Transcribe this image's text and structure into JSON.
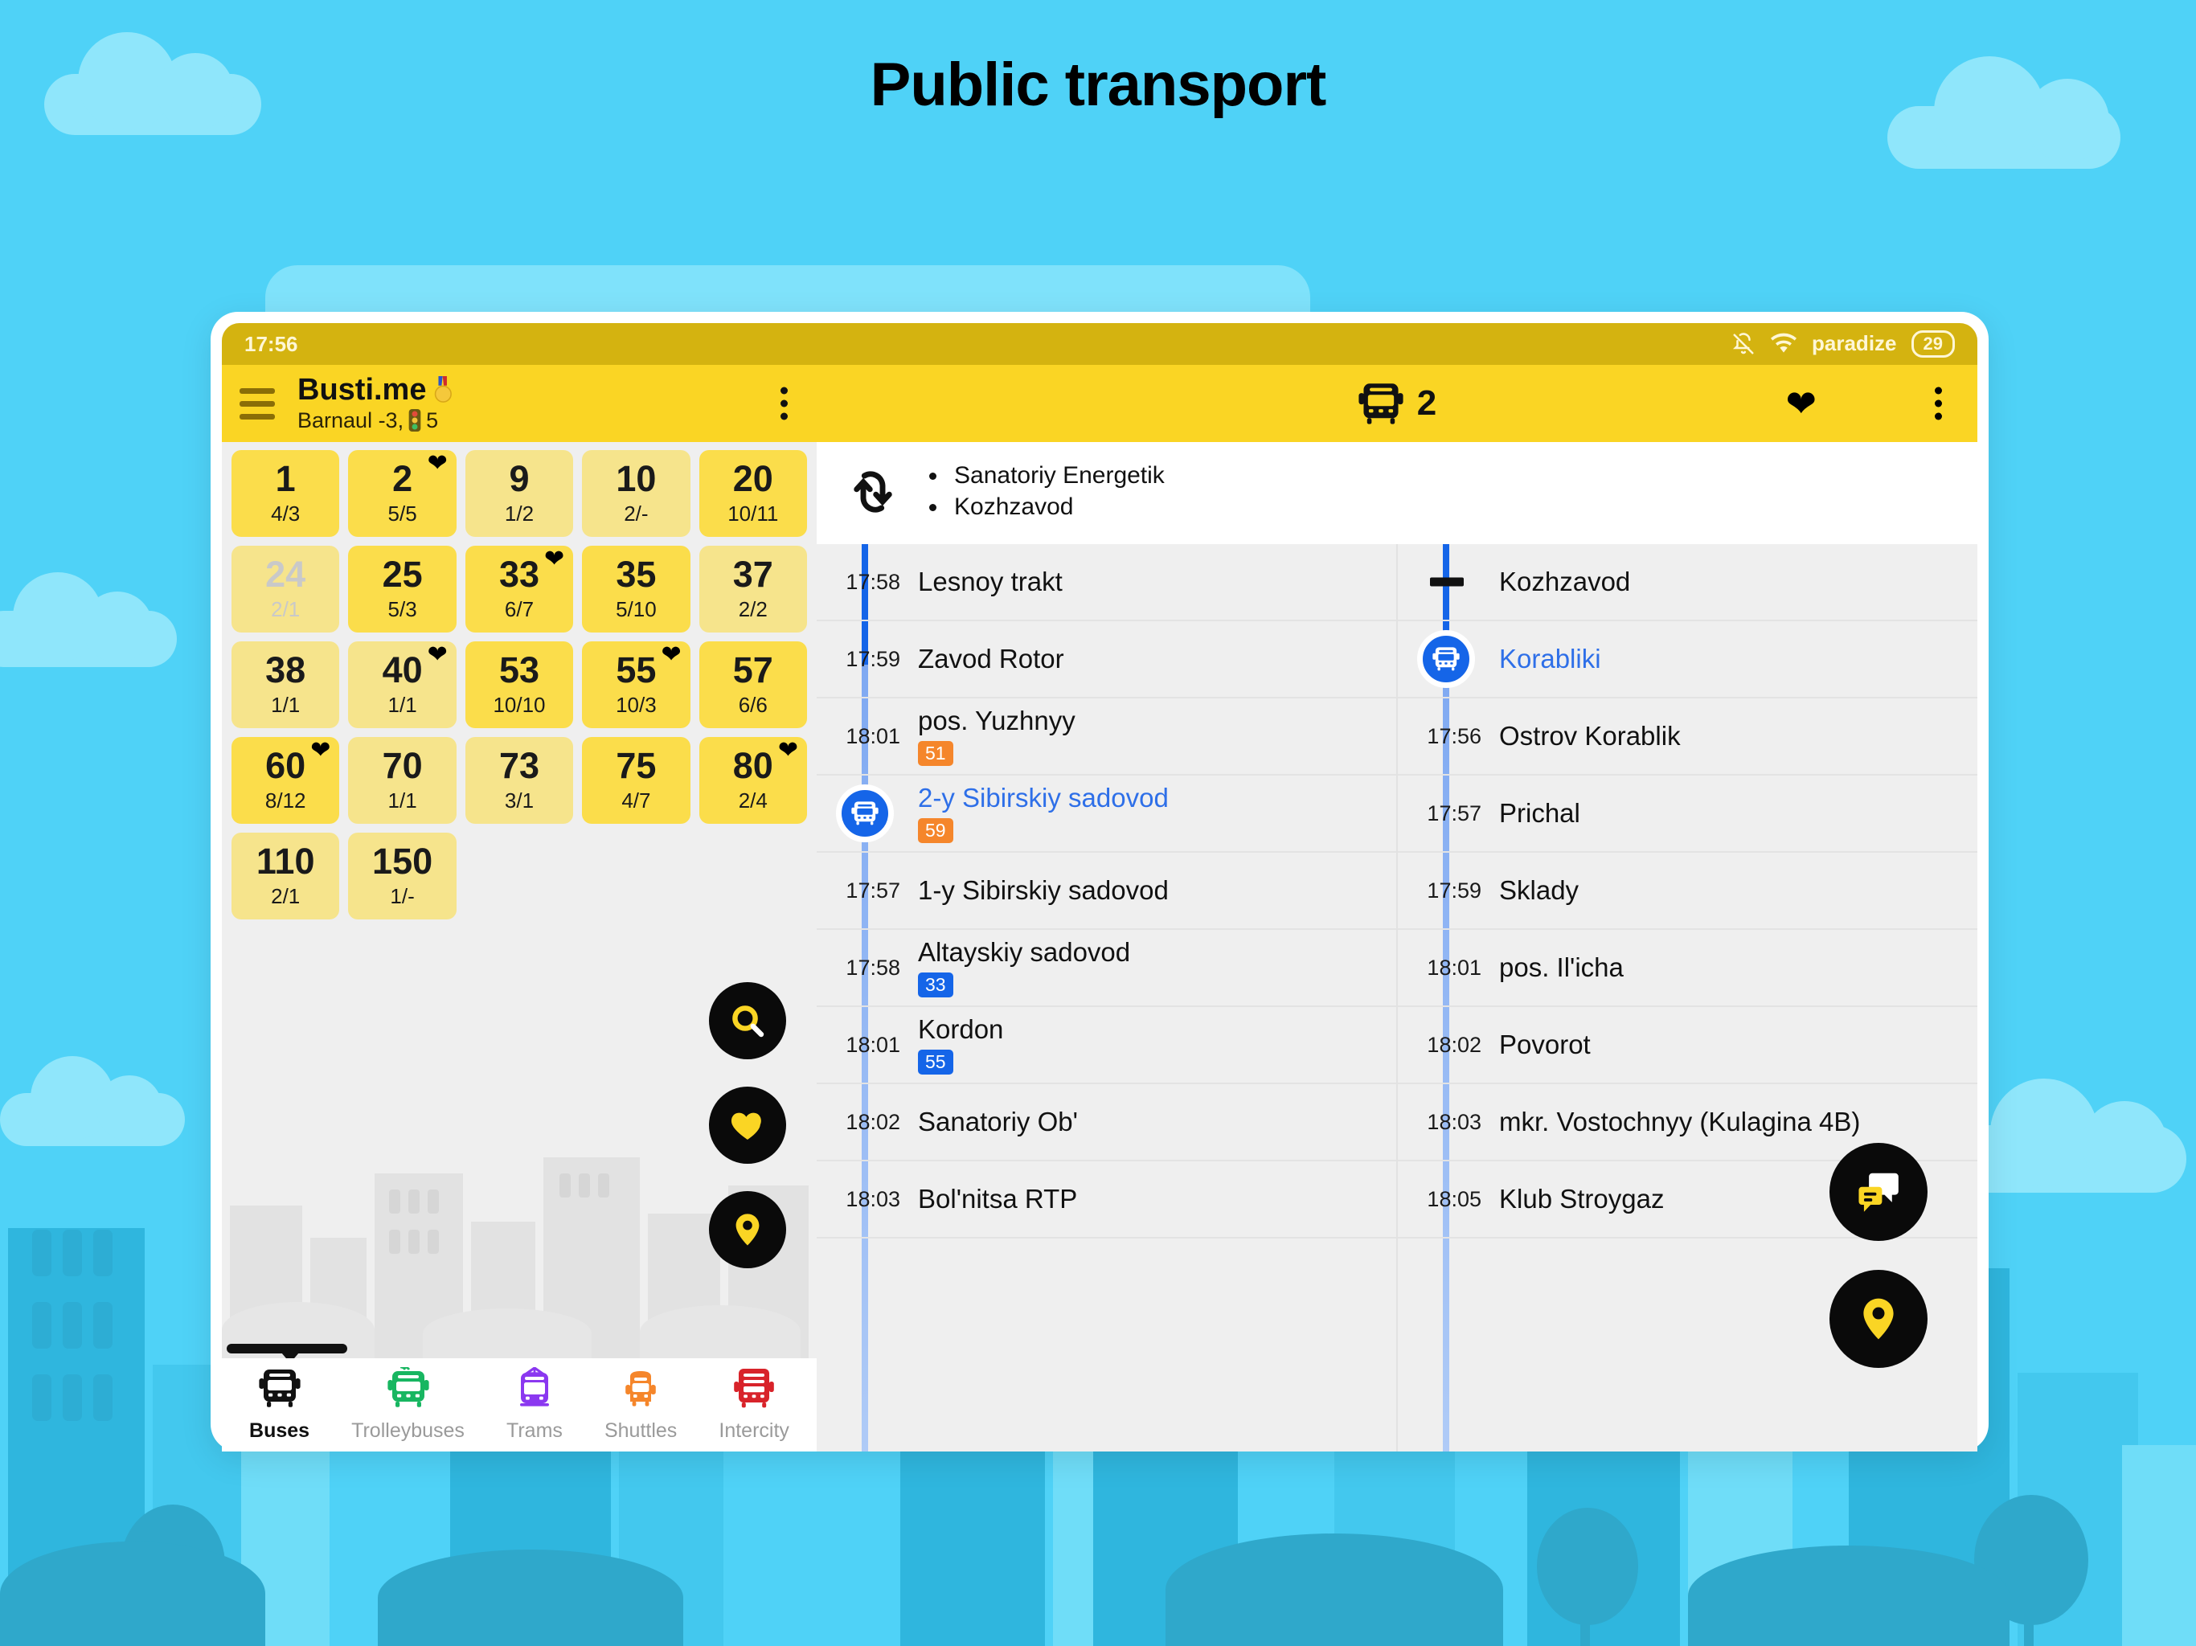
{
  "page": {
    "title": "Public transport"
  },
  "status_bar": {
    "time": "17:56",
    "mute_icon": "bell-off-icon",
    "wifi_icon": "wifi-icon",
    "ssid": "paradize",
    "battery": "29"
  },
  "app_bar": {
    "menu_icon": "hamburger-menu-icon",
    "brand": "Busti.me",
    "brand_badge_icon": "medal-icon",
    "subtitle_city": "Barnaul -3,",
    "subtitle_traffic_icon": "traffic-light-icon",
    "subtitle_count": "5",
    "overflow_icon": "kebab-menu-icon",
    "route_icon": "bus-icon",
    "route_number": "2",
    "favorite_icon": "heart-icon",
    "overflow_right_icon": "kebab-menu-icon"
  },
  "routes": [
    {
      "number": "1",
      "sub": "4/3",
      "fav": false,
      "tone": "bright",
      "dim": false
    },
    {
      "number": "2",
      "sub": "5/5",
      "fav": true,
      "tone": "bright",
      "dim": false
    },
    {
      "number": "9",
      "sub": "1/2",
      "fav": false,
      "tone": "pale",
      "dim": false
    },
    {
      "number": "10",
      "sub": "2/-",
      "fav": false,
      "tone": "pale",
      "dim": false
    },
    {
      "number": "20",
      "sub": "10/11",
      "fav": false,
      "tone": "bright",
      "dim": false
    },
    {
      "number": "24",
      "sub": "2/1",
      "fav": false,
      "tone": "pale",
      "dim": true
    },
    {
      "number": "25",
      "sub": "5/3",
      "fav": false,
      "tone": "bright",
      "dim": false
    },
    {
      "number": "33",
      "sub": "6/7",
      "fav": true,
      "tone": "bright",
      "dim": false
    },
    {
      "number": "35",
      "sub": "5/10",
      "fav": false,
      "tone": "bright",
      "dim": false
    },
    {
      "number": "37",
      "sub": "2/2",
      "fav": false,
      "tone": "pale",
      "dim": false
    },
    {
      "number": "38",
      "sub": "1/1",
      "fav": false,
      "tone": "pale",
      "dim": false
    },
    {
      "number": "40",
      "sub": "1/1",
      "fav": true,
      "tone": "pale",
      "dim": false
    },
    {
      "number": "53",
      "sub": "10/10",
      "fav": false,
      "tone": "bright",
      "dim": false
    },
    {
      "number": "55",
      "sub": "10/3",
      "fav": true,
      "tone": "bright",
      "dim": false
    },
    {
      "number": "57",
      "sub": "6/6",
      "fav": false,
      "tone": "bright",
      "dim": false
    },
    {
      "number": "60",
      "sub": "8/12",
      "fav": true,
      "tone": "bright",
      "dim": false
    },
    {
      "number": "70",
      "sub": "1/1",
      "fav": false,
      "tone": "pale",
      "dim": false
    },
    {
      "number": "73",
      "sub": "3/1",
      "fav": false,
      "tone": "pale",
      "dim": false
    },
    {
      "number": "75",
      "sub": "4/7",
      "fav": false,
      "tone": "bright",
      "dim": false
    },
    {
      "number": "80",
      "sub": "2/4",
      "fav": true,
      "tone": "bright",
      "dim": false
    },
    {
      "number": "110",
      "sub": "2/1",
      "fav": false,
      "tone": "pale",
      "dim": false
    },
    {
      "number": "150",
      "sub": "1/-",
      "fav": false,
      "tone": "pale",
      "dim": false
    }
  ],
  "left_fabs": [
    {
      "name": "search-fab",
      "icon": "search-icon"
    },
    {
      "name": "favorites-fab",
      "icon": "heart-icon"
    },
    {
      "name": "location-fab",
      "icon": "map-pin-icon"
    }
  ],
  "bottom_nav": [
    {
      "label": "Buses",
      "icon": "bus-icon",
      "color": "#111111",
      "active": true
    },
    {
      "label": "Trolleybuses",
      "icon": "trolleybus-icon",
      "color": "#18B661",
      "active": false
    },
    {
      "label": "Trams",
      "icon": "tram-icon",
      "color": "#8B38F0",
      "active": false
    },
    {
      "label": "Shuttles",
      "icon": "minibus-icon",
      "color": "#F5862B",
      "active": false
    },
    {
      "label": "Intercity",
      "icon": "coach-icon",
      "color": "#D8232A",
      "active": false
    }
  ],
  "direction_header": {
    "loop_icon": "loop-arrows-icon",
    "terminals": [
      "Sanatoriy Energetik",
      "Kozhzavod"
    ]
  },
  "stops_left": [
    {
      "time": "17:58",
      "name": "Lesnoy trakt",
      "badge": null,
      "badge_color": null,
      "current": false,
      "marker": null
    },
    {
      "time": "17:59",
      "name": "Zavod Rotor",
      "badge": null,
      "badge_color": null,
      "current": false,
      "marker": null
    },
    {
      "time": "18:01",
      "name": "pos. Yuzhnyy",
      "badge": "51",
      "badge_color": "orange",
      "current": false,
      "marker": null
    },
    {
      "time": "",
      "name": "2-y Sibirskiy sadovod",
      "badge": "59",
      "badge_color": "orange",
      "current": true,
      "marker": "bus-marker"
    },
    {
      "time": "17:57",
      "name": "1-y Sibirskiy sadovod",
      "badge": null,
      "badge_color": null,
      "current": false,
      "marker": null
    },
    {
      "time": "17:58",
      "name": "Altayskiy sadovod",
      "badge": "33",
      "badge_color": "blue",
      "current": false,
      "marker": null
    },
    {
      "time": "18:01",
      "name": "Kordon",
      "badge": "55",
      "badge_color": "blue",
      "current": false,
      "marker": null
    },
    {
      "time": "18:02",
      "name": "Sanatoriy Ob'",
      "badge": null,
      "badge_color": null,
      "current": false,
      "marker": null
    },
    {
      "time": "18:03",
      "name": "Bol'nitsa RTP",
      "badge": null,
      "badge_color": null,
      "current": false,
      "marker": null
    }
  ],
  "stops_right": [
    {
      "time": "",
      "name": "Kozhzavod",
      "badge": null,
      "badge_color": null,
      "current": false,
      "marker": "terminus-cap"
    },
    {
      "time": "",
      "name": "Korabliki",
      "badge": null,
      "badge_color": null,
      "current": true,
      "marker": "bus-marker"
    },
    {
      "time": "17:56",
      "name": "Ostrov Korablik",
      "badge": null,
      "badge_color": null,
      "current": false,
      "marker": null
    },
    {
      "time": "17:57",
      "name": "Prichal",
      "badge": null,
      "badge_color": null,
      "current": false,
      "marker": null
    },
    {
      "time": "17:59",
      "name": "Sklady",
      "badge": null,
      "badge_color": null,
      "current": false,
      "marker": null
    },
    {
      "time": "18:01",
      "name": "pos. Il'icha",
      "badge": null,
      "badge_color": null,
      "current": false,
      "marker": null
    },
    {
      "time": "18:02",
      "name": "Povorot",
      "badge": null,
      "badge_color": null,
      "current": false,
      "marker": null
    },
    {
      "time": "18:03",
      "name": "mkr. Vostochnyy (Kulagina 4B)",
      "badge": null,
      "badge_color": null,
      "current": false,
      "marker": null
    },
    {
      "time": "18:05",
      "name": "Klub Stroygaz",
      "badge": null,
      "badge_color": null,
      "current": false,
      "marker": null
    }
  ],
  "right_fabs": [
    {
      "name": "chat-fab",
      "icon": "chat-bubbles-icon"
    },
    {
      "name": "map-fab",
      "icon": "map-pin-icon"
    }
  ],
  "colors": {
    "sky": "#4FD2F7",
    "cloud": "#8FE6FB",
    "brand_yellow": "#FAD524",
    "status_yellow": "#D4B310",
    "accent_blue": "#1565E8",
    "link_blue": "#2E6FE8",
    "badge_orange": "#F5862B",
    "fab_black": "#0A0A0A",
    "pane_grey": "#EFEFEF"
  }
}
